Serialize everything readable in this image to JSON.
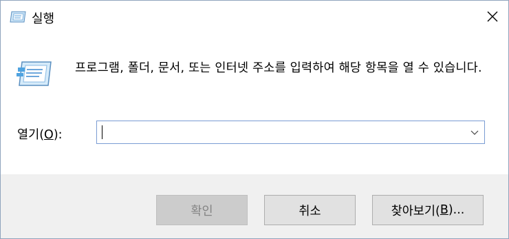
{
  "window": {
    "title": "실행",
    "title_icon": "run-dialog-icon",
    "close_icon": "close-icon"
  },
  "content": {
    "icon": "run-dialog-icon",
    "description": "프로그램, 폴더, 문서, 또는 인터넷 주소를 입력하여 해당 항목을 열 수 있습니다.",
    "open_label_prefix": "열기(",
    "open_label_accel": "O",
    "open_label_suffix": "):",
    "open_value": "",
    "dropdown_icon": "chevron-down-icon"
  },
  "buttons": {
    "ok_label": "확인",
    "ok_disabled": true,
    "cancel_label": "취소",
    "browse_prefix": "찾아보기(",
    "browse_accel": "B",
    "browse_suffix": ")..."
  },
  "colors": {
    "footer_bg": "#f0f0f0",
    "input_border": "#7a9cd3",
    "disabled_button_bg": "#cccccc"
  }
}
